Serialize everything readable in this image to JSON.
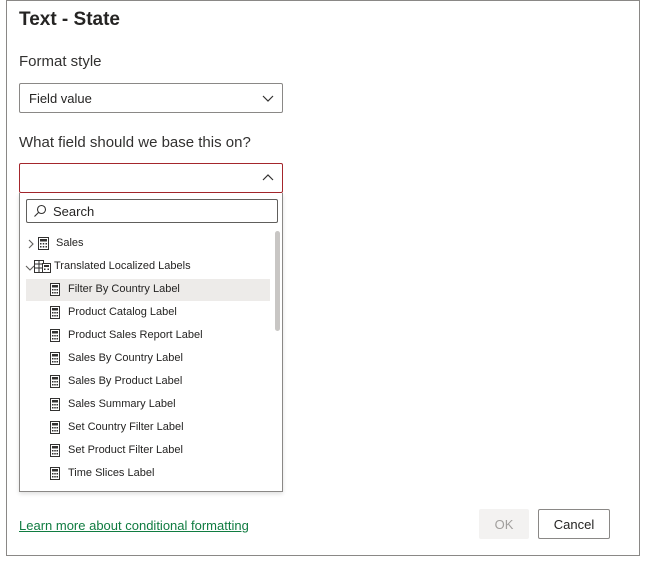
{
  "dialog": {
    "title": "Text - State",
    "format_style_label": "Format style",
    "format_style_value": "Field value",
    "base_field_label": "What field should we base this on?",
    "base_field_value": "",
    "search_placeholder": "Search",
    "tree": [
      {
        "label": "Sales",
        "type": "table",
        "expanded": false,
        "level": 0
      },
      {
        "label": "Translated Localized Labels",
        "type": "table",
        "expanded": true,
        "level": 0
      },
      {
        "label": "Filter By Country Label",
        "type": "measure",
        "level": 1,
        "selected": true
      },
      {
        "label": "Product Catalog Label",
        "type": "measure",
        "level": 1
      },
      {
        "label": "Product Sales Report Label",
        "type": "measure",
        "level": 1
      },
      {
        "label": "Sales By Country Label",
        "type": "measure",
        "level": 1
      },
      {
        "label": "Sales By Product Label",
        "type": "measure",
        "level": 1
      },
      {
        "label": "Sales Summary Label",
        "type": "measure",
        "level": 1
      },
      {
        "label": "Set Country Filter Label",
        "type": "measure",
        "level": 1
      },
      {
        "label": "Set Product Filter Label",
        "type": "measure",
        "level": 1
      },
      {
        "label": "Time Slices Label",
        "type": "measure",
        "level": 1
      }
    ],
    "learn_more_link": "Learn more about conditional formatting",
    "ok_label": "OK",
    "cancel_label": "Cancel"
  },
  "colors": {
    "link": "#107c41",
    "error_border": "#a4262c",
    "selected_row": "#edebe9",
    "disabled_text": "#a19f9d"
  }
}
